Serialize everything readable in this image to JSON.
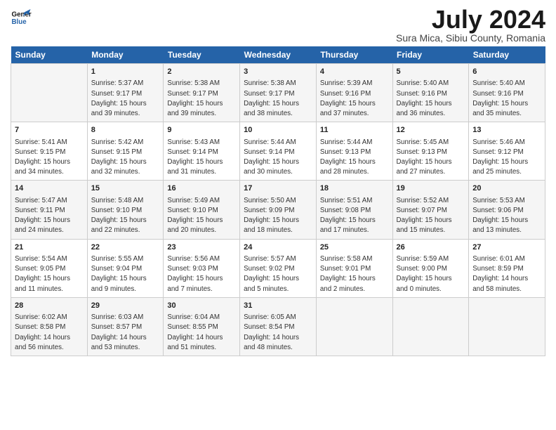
{
  "header": {
    "logo_line1": "General",
    "logo_line2": "Blue",
    "title": "July 2024",
    "subtitle": "Sura Mica, Sibiu County, Romania"
  },
  "days_of_week": [
    "Sunday",
    "Monday",
    "Tuesday",
    "Wednesday",
    "Thursday",
    "Friday",
    "Saturday"
  ],
  "weeks": [
    [
      {
        "day": "",
        "info": ""
      },
      {
        "day": "1",
        "info": "Sunrise: 5:37 AM\nSunset: 9:17 PM\nDaylight: 15 hours\nand 39 minutes."
      },
      {
        "day": "2",
        "info": "Sunrise: 5:38 AM\nSunset: 9:17 PM\nDaylight: 15 hours\nand 39 minutes."
      },
      {
        "day": "3",
        "info": "Sunrise: 5:38 AM\nSunset: 9:17 PM\nDaylight: 15 hours\nand 38 minutes."
      },
      {
        "day": "4",
        "info": "Sunrise: 5:39 AM\nSunset: 9:16 PM\nDaylight: 15 hours\nand 37 minutes."
      },
      {
        "day": "5",
        "info": "Sunrise: 5:40 AM\nSunset: 9:16 PM\nDaylight: 15 hours\nand 36 minutes."
      },
      {
        "day": "6",
        "info": "Sunrise: 5:40 AM\nSunset: 9:16 PM\nDaylight: 15 hours\nand 35 minutes."
      }
    ],
    [
      {
        "day": "7",
        "info": "Sunrise: 5:41 AM\nSunset: 9:15 PM\nDaylight: 15 hours\nand 34 minutes."
      },
      {
        "day": "8",
        "info": "Sunrise: 5:42 AM\nSunset: 9:15 PM\nDaylight: 15 hours\nand 32 minutes."
      },
      {
        "day": "9",
        "info": "Sunrise: 5:43 AM\nSunset: 9:14 PM\nDaylight: 15 hours\nand 31 minutes."
      },
      {
        "day": "10",
        "info": "Sunrise: 5:44 AM\nSunset: 9:14 PM\nDaylight: 15 hours\nand 30 minutes."
      },
      {
        "day": "11",
        "info": "Sunrise: 5:44 AM\nSunset: 9:13 PM\nDaylight: 15 hours\nand 28 minutes."
      },
      {
        "day": "12",
        "info": "Sunrise: 5:45 AM\nSunset: 9:13 PM\nDaylight: 15 hours\nand 27 minutes."
      },
      {
        "day": "13",
        "info": "Sunrise: 5:46 AM\nSunset: 9:12 PM\nDaylight: 15 hours\nand 25 minutes."
      }
    ],
    [
      {
        "day": "14",
        "info": "Sunrise: 5:47 AM\nSunset: 9:11 PM\nDaylight: 15 hours\nand 24 minutes."
      },
      {
        "day": "15",
        "info": "Sunrise: 5:48 AM\nSunset: 9:10 PM\nDaylight: 15 hours\nand 22 minutes."
      },
      {
        "day": "16",
        "info": "Sunrise: 5:49 AM\nSunset: 9:10 PM\nDaylight: 15 hours\nand 20 minutes."
      },
      {
        "day": "17",
        "info": "Sunrise: 5:50 AM\nSunset: 9:09 PM\nDaylight: 15 hours\nand 18 minutes."
      },
      {
        "day": "18",
        "info": "Sunrise: 5:51 AM\nSunset: 9:08 PM\nDaylight: 15 hours\nand 17 minutes."
      },
      {
        "day": "19",
        "info": "Sunrise: 5:52 AM\nSunset: 9:07 PM\nDaylight: 15 hours\nand 15 minutes."
      },
      {
        "day": "20",
        "info": "Sunrise: 5:53 AM\nSunset: 9:06 PM\nDaylight: 15 hours\nand 13 minutes."
      }
    ],
    [
      {
        "day": "21",
        "info": "Sunrise: 5:54 AM\nSunset: 9:05 PM\nDaylight: 15 hours\nand 11 minutes."
      },
      {
        "day": "22",
        "info": "Sunrise: 5:55 AM\nSunset: 9:04 PM\nDaylight: 15 hours\nand 9 minutes."
      },
      {
        "day": "23",
        "info": "Sunrise: 5:56 AM\nSunset: 9:03 PM\nDaylight: 15 hours\nand 7 minutes."
      },
      {
        "day": "24",
        "info": "Sunrise: 5:57 AM\nSunset: 9:02 PM\nDaylight: 15 hours\nand 5 minutes."
      },
      {
        "day": "25",
        "info": "Sunrise: 5:58 AM\nSunset: 9:01 PM\nDaylight: 15 hours\nand 2 minutes."
      },
      {
        "day": "26",
        "info": "Sunrise: 5:59 AM\nSunset: 9:00 PM\nDaylight: 15 hours\nand 0 minutes."
      },
      {
        "day": "27",
        "info": "Sunrise: 6:01 AM\nSunset: 8:59 PM\nDaylight: 14 hours\nand 58 minutes."
      }
    ],
    [
      {
        "day": "28",
        "info": "Sunrise: 6:02 AM\nSunset: 8:58 PM\nDaylight: 14 hours\nand 56 minutes."
      },
      {
        "day": "29",
        "info": "Sunrise: 6:03 AM\nSunset: 8:57 PM\nDaylight: 14 hours\nand 53 minutes."
      },
      {
        "day": "30",
        "info": "Sunrise: 6:04 AM\nSunset: 8:55 PM\nDaylight: 14 hours\nand 51 minutes."
      },
      {
        "day": "31",
        "info": "Sunrise: 6:05 AM\nSunset: 8:54 PM\nDaylight: 14 hours\nand 48 minutes."
      },
      {
        "day": "",
        "info": ""
      },
      {
        "day": "",
        "info": ""
      },
      {
        "day": "",
        "info": ""
      }
    ]
  ]
}
